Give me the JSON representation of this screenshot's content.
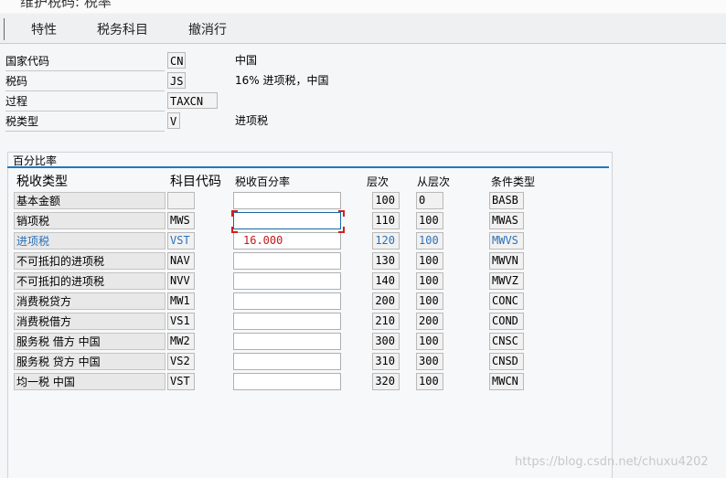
{
  "window": {
    "title": "维护税码: 税率"
  },
  "toolbar": {
    "items": [
      "特性",
      "税务科目",
      "撤消行"
    ]
  },
  "header": {
    "fields": [
      {
        "label": "国家代码",
        "value": "CN",
        "desc": "中国"
      },
      {
        "label": "税码",
        "value": "JS",
        "desc": "16% 进项税，中国"
      },
      {
        "label": "过程",
        "value": "TAXCN",
        "desc": ""
      },
      {
        "label": "税类型",
        "value": "V",
        "desc": "进项税"
      }
    ]
  },
  "percent_panel": {
    "title": "百分比率",
    "columns": {
      "tax_type": "税收类型",
      "account_key": "科目代码",
      "tax_percent": "税收百分率",
      "level": "层次",
      "from_level": "从层次",
      "cond_type": "条件类型"
    },
    "rows": [
      {
        "name": "基本金额",
        "key": "",
        "percent": "",
        "level": "100",
        "from": "0",
        "cond": "BASB"
      },
      {
        "name": "销项税",
        "key": "MWS",
        "percent": "",
        "level": "110",
        "from": "100",
        "cond": "MWAS"
      },
      {
        "name": "进项税",
        "key": "VST",
        "percent": "16.000",
        "level": "120",
        "from": "100",
        "cond": "MWVS"
      },
      {
        "name": "不可抵扣的进项税",
        "key": "NAV",
        "percent": "",
        "level": "130",
        "from": "100",
        "cond": "MWVN"
      },
      {
        "name": "不可抵扣的进项税",
        "key": "NVV",
        "percent": "",
        "level": "140",
        "from": "100",
        "cond": "MWVZ"
      },
      {
        "name": "消费税贷方",
        "key": "MW1",
        "percent": "",
        "level": "200",
        "from": "100",
        "cond": "CONC"
      },
      {
        "name": "消费税借方",
        "key": "VS1",
        "percent": "",
        "level": "210",
        "from": "200",
        "cond": "COND"
      },
      {
        "name": "服务税 借方 中国",
        "key": "MW2",
        "percent": "",
        "level": "300",
        "from": "100",
        "cond": "CNSC"
      },
      {
        "name": "服务税 贷方 中国",
        "key": "VS2",
        "percent": "",
        "level": "310",
        "from": "300",
        "cond": "CNSD"
      },
      {
        "name": "均一税 中国",
        "key": "VST",
        "percent": "",
        "level": "320",
        "from": "100",
        "cond": "MWCN"
      }
    ]
  },
  "watermark": "https://blog.csdn.net/chuxu4202",
  "colors": {
    "accent": "#1f78c0",
    "highlight_text": "#2c70b8",
    "value_red": "#c21818"
  }
}
